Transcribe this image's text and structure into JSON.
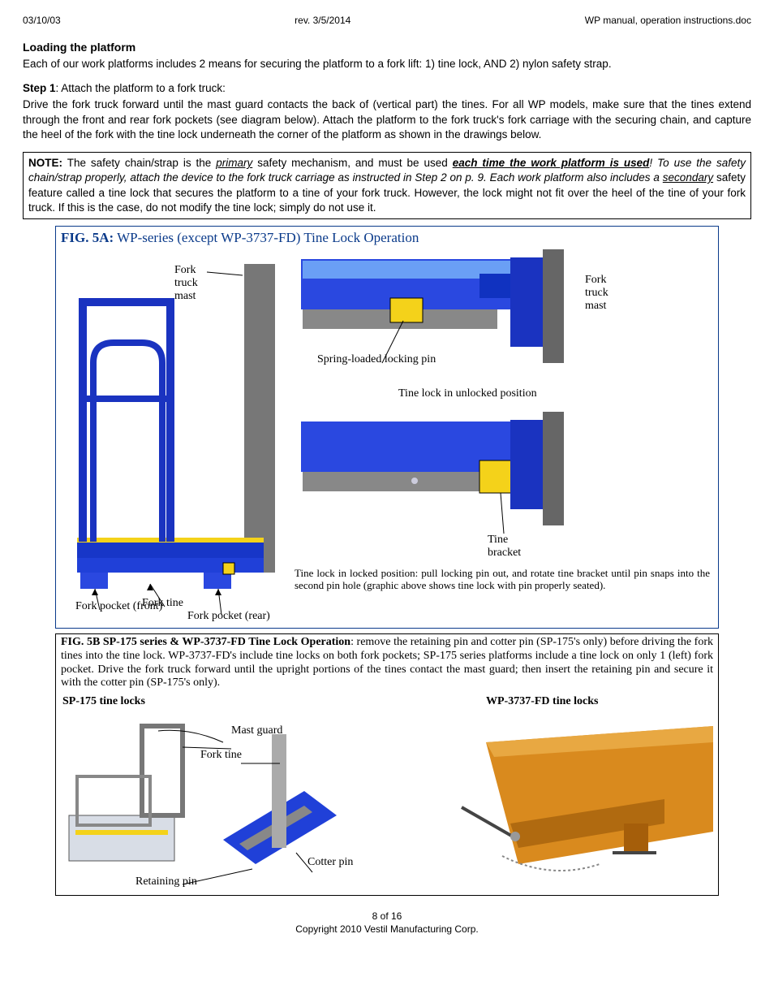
{
  "header": {
    "left": "03/10/03",
    "center": "rev. 3/5/2014",
    "right": "WP manual, operation instructions.doc"
  },
  "section_title": "Loading the platform",
  "intro": "Each of our work platforms includes 2 means for securing the platform to a fork lift: 1) tine lock, AND 2) nylon safety strap.",
  "step1_label": "Step 1",
  "step1_rest": ": Attach the platform to a fork truck:",
  "step1_body": "Drive the fork truck forward until the mast guard contacts the back of (vertical part) the tines. For all WP models, make sure that the tines extend through the front and rear fork pockets (see diagram below).  Attach the platform to the fork truck's fork carriage with the securing chain, and capture the heel of the fork with the tine lock underneath the corner of the platform as shown in the drawings below.",
  "note": {
    "label": "NOTE:",
    "p1a": " The safety chain/strap is the ",
    "primary": "primary",
    "p1b": " safety mechanism, and must be used ",
    "eachtime": "each time the work platform is used",
    "p1c": "! To use the safety chain/strap properly, attach the device to the fork truck carriage as instructed in Step 2 on p. 9. Each work platform also includes a ",
    "secondary": "secondary",
    "p1d": " safety feature called a tine lock that secures the platform to a tine of your fork truck. However, the lock might not fit over the heel of the tine of your fork truck. If this is the case, do not modify the tine lock; simply do not use it."
  },
  "fig5a": {
    "title_b": "FIG. 5A:",
    "title_rest": " WP-series (except WP-3737-FD) Tine Lock Operation",
    "labels": {
      "fork_truck_mast": "Fork truck mast",
      "fork_pocket_front": "Fork pocket (front)",
      "fork_tine": "Fork tine",
      "fork_pocket_rear": "Fork pocket (rear)",
      "spring_pin": "Spring-loaded locking pin",
      "unlocked": "Tine lock in unlocked position",
      "tine_bracket": "Tine bracket",
      "locked_caption": "Tine lock in locked position: pull locking pin out, and rotate tine bracket until pin snaps into the second pin hole (graphic above shows tine lock with pin properly seated)."
    }
  },
  "fig5b": {
    "title_b": "FIG. 5B SP-175 series & WP-3737-FD Tine Lock Operation",
    "body": ": remove the retaining pin and cotter pin (SP-175's only) before driving the fork tines into the tine lock. WP-3737-FD's include tine locks on both fork pockets; SP-175 series platforms include a tine lock on only 1 (left) fork pocket.  Drive the fork truck forward until the upright portions of the tines contact the mast guard; then insert the retaining pin and secure it with the cotter pin (SP-175's only).",
    "sp175_label": "SP-175 tine locks",
    "wp_label": "WP-3737-FD tine locks",
    "mast_guard": "Mast guard",
    "fork_tine": "Fork tine",
    "cotter_pin": "Cotter pin",
    "retaining_pin": "Retaining pin"
  },
  "footer": {
    "page": "8 of 16",
    "copyright": "Copyright 2010 Vestil Manufacturing Corp."
  }
}
